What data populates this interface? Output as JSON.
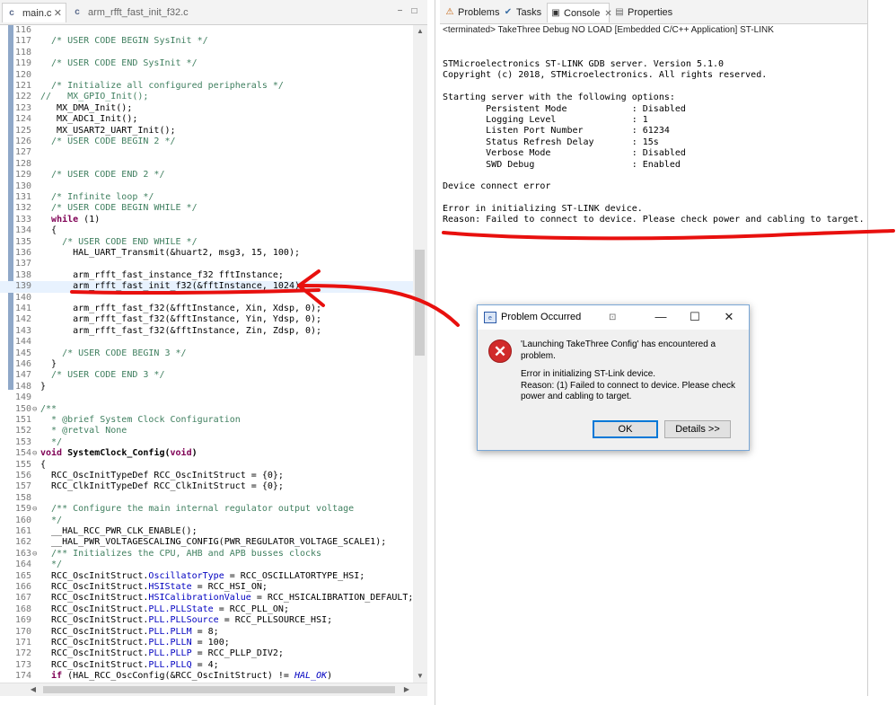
{
  "editor": {
    "tabs": [
      {
        "icon": "c-file-icon",
        "label": "main.c",
        "close": "✕",
        "active": true
      },
      {
        "icon": "c-file-icon",
        "label": "arm_rfft_fast_init_f32.c",
        "active": false
      }
    ],
    "window_controls": [
      "−",
      "□"
    ],
    "lines": [
      {
        "n": "116",
        "t": ""
      },
      {
        "n": "117",
        "t": "  /* USER CODE BEGIN SysInit */",
        "c": "com"
      },
      {
        "n": "118",
        "t": ""
      },
      {
        "n": "119",
        "t": "  /* USER CODE END SysInit */",
        "c": "com"
      },
      {
        "n": "120",
        "t": ""
      },
      {
        "n": "121",
        "t": "  /* Initialize all configured peripherals */",
        "c": "com"
      },
      {
        "n": "122",
        "t": "//   MX_GPIO_Init();",
        "c": "com"
      },
      {
        "n": "123",
        "t": "   MX_DMA_Init();"
      },
      {
        "n": "124",
        "t": "   MX_ADC1_Init();"
      },
      {
        "n": "125",
        "t": "   MX_USART2_UART_Init();"
      },
      {
        "n": "126",
        "t": "  /* USER CODE BEGIN 2 */",
        "c": "com"
      },
      {
        "n": "127",
        "t": ""
      },
      {
        "n": "128",
        "t": ""
      },
      {
        "n": "129",
        "t": "  /* USER CODE END 2 */",
        "c": "com"
      },
      {
        "n": "130",
        "t": ""
      },
      {
        "n": "131",
        "t": "  /* Infinite loop */",
        "c": "com"
      },
      {
        "n": "132",
        "t": "  /* USER CODE BEGIN WHILE */",
        "c": "com"
      },
      {
        "n": "133",
        "t": "  while (1)",
        "c": "kwlead"
      },
      {
        "n": "134",
        "t": "  {"
      },
      {
        "n": "135",
        "t": "    /* USER CODE END WHILE */",
        "c": "com"
      },
      {
        "n": "136",
        "t": "      HAL_UART_Transmit(&huart2, msg3, 15, 100);"
      },
      {
        "n": "137",
        "t": ""
      },
      {
        "n": "138",
        "t": "      arm_rfft_fast_instance_f32 fftInstance;"
      },
      {
        "n": "139",
        "t": "      arm_rfft_fast_init_f32(&fftInstance, 1024);",
        "hl": true
      },
      {
        "n": "140",
        "t": ""
      },
      {
        "n": "141",
        "t": "      arm_rfft_fast_f32(&fftInstance, Xin, Xdsp, 0);"
      },
      {
        "n": "142",
        "t": "      arm_rfft_fast_f32(&fftInstance, Yin, Ydsp, 0);"
      },
      {
        "n": "143",
        "t": "      arm_rfft_fast_f32(&fftInstance, Zin, Zdsp, 0);"
      },
      {
        "n": "144",
        "t": ""
      },
      {
        "n": "145",
        "t": "    /* USER CODE BEGIN 3 */",
        "c": "com"
      },
      {
        "n": "146",
        "t": "  }"
      },
      {
        "n": "147",
        "t": "  /* USER CODE END 3 */",
        "c": "com"
      },
      {
        "n": "148",
        "t": "}"
      },
      {
        "n": "149",
        "t": ""
      },
      {
        "n": "150",
        "f": "⊖",
        "t": "/**",
        "c": "com"
      },
      {
        "n": "151",
        "t": "  * @brief System Clock Configuration",
        "c": "com"
      },
      {
        "n": "152",
        "t": "  * @retval None",
        "c": "com"
      },
      {
        "n": "153",
        "t": "  */",
        "c": "com"
      },
      {
        "n": "154",
        "f": "⊖",
        "t": "void SystemClock_Config(void)",
        "c": "func"
      },
      {
        "n": "155",
        "t": "{"
      },
      {
        "n": "156",
        "t": "  RCC_OscInitTypeDef RCC_OscInitStruct = {0};"
      },
      {
        "n": "157",
        "t": "  RCC_ClkInitTypeDef RCC_ClkInitStruct = {0};"
      },
      {
        "n": "158",
        "t": ""
      },
      {
        "n": "159",
        "f": "⊖",
        "t": "  /** Configure the main internal regulator output voltage",
        "c": "com"
      },
      {
        "n": "160",
        "t": "  */",
        "c": "com"
      },
      {
        "n": "161",
        "t": "  __HAL_RCC_PWR_CLK_ENABLE();"
      },
      {
        "n": "162",
        "t": "  __HAL_PWR_VOLTAGESCALING_CONFIG(PWR_REGULATOR_VOLTAGE_SCALE1);"
      },
      {
        "n": "163",
        "f": "⊖",
        "t": "  /** Initializes the CPU, AHB and APB busses clocks",
        "c": "com"
      },
      {
        "n": "164",
        "t": "  */",
        "c": "com"
      },
      {
        "n": "165",
        "t": "  RCC_OscInitStruct.",
        "fld": "OscillatorType",
        "rest": " = RCC_OSCILLATORTYPE_HSI;"
      },
      {
        "n": "166",
        "t": "  RCC_OscInitStruct.",
        "fld": "HSIState",
        "rest": " = RCC_HSI_ON;"
      },
      {
        "n": "167",
        "t": "  RCC_OscInitStruct.",
        "fld": "HSICalibrationValue",
        "rest": " = RCC_HSICALIBRATION_DEFAULT;"
      },
      {
        "n": "168",
        "t": "  RCC_OscInitStruct.",
        "fld": "PLL.PLLState",
        "rest": " = RCC_PLL_ON;"
      },
      {
        "n": "169",
        "t": "  RCC_OscInitStruct.",
        "fld": "PLL.PLLSource",
        "rest": " = RCC_PLLSOURCE_HSI;"
      },
      {
        "n": "170",
        "t": "  RCC_OscInitStruct.",
        "fld": "PLL.PLLM",
        "rest": " = 8;"
      },
      {
        "n": "171",
        "t": "  RCC_OscInitStruct.",
        "fld": "PLL.PLLN",
        "rest": " = 100;"
      },
      {
        "n": "172",
        "t": "  RCC_OscInitStruct.",
        "fld": "PLL.PLLP",
        "rest": " = RCC_PLLP_DIV2;"
      },
      {
        "n": "173",
        "t": "  RCC_OscInitStruct.",
        "fld": "PLL.PLLQ",
        "rest": " = 4;"
      },
      {
        "n": "174",
        "t": "  if (HAL_RCC_OscConfig(&RCC_OscInitStruct) != HAL_OK)",
        "c": "if"
      }
    ]
  },
  "console": {
    "tabs": [
      {
        "icon": "problems-icon",
        "label": "Problems"
      },
      {
        "icon": "tasks-icon",
        "label": "Tasks"
      },
      {
        "icon": "console-icon",
        "label": "Console",
        "close": "✕",
        "active": true
      },
      {
        "icon": "properties-icon",
        "label": "Properties"
      }
    ],
    "terminated": "<terminated> TakeThree Debug NO LOAD [Embedded C/C++ Application] ST-LINK",
    "output": [
      "STMicroelectronics ST-LINK GDB server. Version 5.1.0",
      "Copyright (c) 2018, STMicroelectronics. All rights reserved.",
      "",
      "Starting server with the following options:",
      "        Persistent Mode            : Disabled",
      "        Logging Level              : 1",
      "        Listen Port Number         : 61234",
      "        Status Refresh Delay       : 15s",
      "        Verbose Mode               : Disabled",
      "        SWD Debug                  : Enabled",
      "",
      "Device connect error",
      "",
      "Error in initializing ST-LINK device.",
      "Reason: Failed to connect to device. Please check power and cabling to target."
    ]
  },
  "dialog": {
    "title": "Problem Occurred",
    "title_controls": {
      "minimize": "—",
      "maximize": "☐",
      "close": "✕"
    },
    "error_glyph": "✕",
    "message_1": "'Launching TakeThree Config' has encountered a problem.",
    "message_2": "Error in initializing ST-Link device.",
    "message_3": "Reason: (1) Failed to connect to device. Please check power and cabling to target.",
    "ok_label": "OK",
    "details_label": "Details >>"
  },
  "colors": {
    "annotation": "#e8100e",
    "comment": "#3f7f5f",
    "keyword": "#7f0055",
    "field": "#0000c0",
    "dialog_accent": "#0078d7"
  }
}
